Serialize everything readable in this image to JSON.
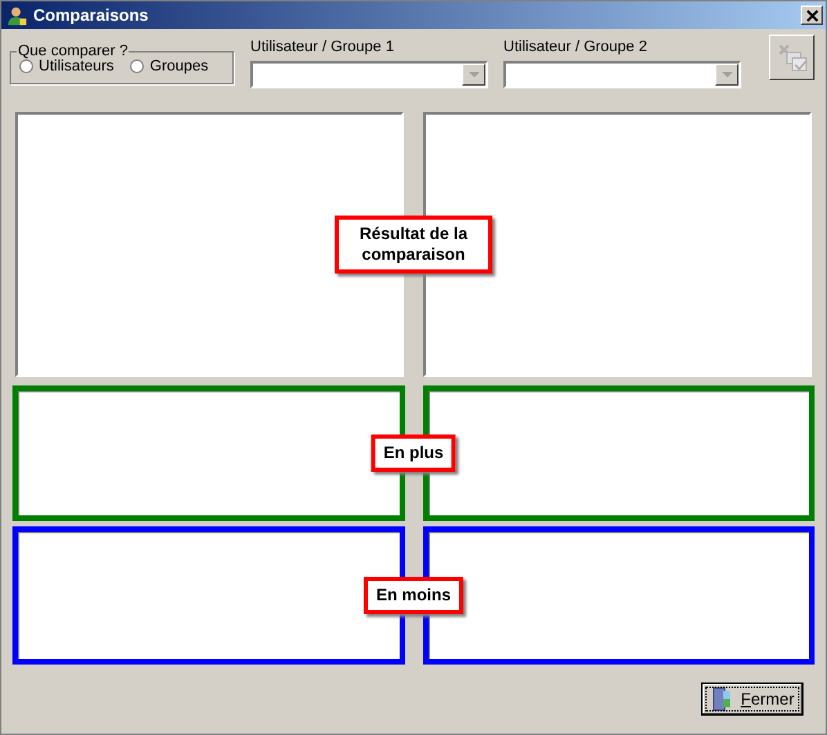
{
  "window": {
    "title": "Comparaisons"
  },
  "compare_group": {
    "legend": "Que comparer ?",
    "options": [
      {
        "label": "Utilisateurs",
        "selected": false
      },
      {
        "label": "Groupes",
        "selected": false
      }
    ]
  },
  "selectors": [
    {
      "label": "Utilisateur / Groupe 1"
    },
    {
      "label": "Utilisateur / Groupe 2"
    }
  ],
  "compare_button": {
    "disabled": true
  },
  "sections": [
    {
      "kind": "plain",
      "callout": "Résultat de la comparaison"
    },
    {
      "kind": "framed",
      "color": "#008000",
      "callout": "En plus"
    },
    {
      "kind": "framed",
      "color": "#0000ff",
      "callout": "En moins"
    }
  ],
  "close_button": {
    "label": "Fermer"
  }
}
